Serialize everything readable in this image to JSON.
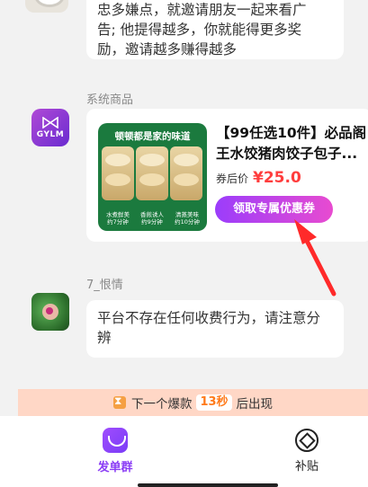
{
  "chat": {
    "top_message": {
      "lines": [
        "忠多嫌点，就邀请朋友一起来看广",
        "告; 他提得越多，你就能得更多奖",
        "励，邀请越多赚得越多"
      ]
    },
    "system_product": {
      "sender": "系统商品",
      "avatar_text": "GYLM",
      "image_slogan": "顿顿都是家的味道",
      "image_captions": [
        "水煮鲜美\n约7分钟",
        "香煎诱人\n约9分钟",
        "清蒸美味\n约10分钟"
      ],
      "title": "【99任选10件】必品阁王水饺猪肉饺子包子...",
      "price_label": "券后价",
      "price": "¥25.0",
      "coupon_button": "领取专属优惠券"
    },
    "user_message": {
      "sender": "7_恨情",
      "text": "平台不存在任何收费行为，请注意分辨"
    }
  },
  "countdown": {
    "prefix": "下一个爆款",
    "time": "13秒",
    "suffix": "后出现"
  },
  "bottom_nav": {
    "items": [
      {
        "label": "发单群",
        "active": true
      },
      {
        "label": "补贴",
        "active": false
      }
    ]
  },
  "colors": {
    "accent": "#8a3cf5",
    "price": "#ff3d3d",
    "countdown_bg": "#ffd7c6",
    "arrow": "#ff2a2a"
  }
}
